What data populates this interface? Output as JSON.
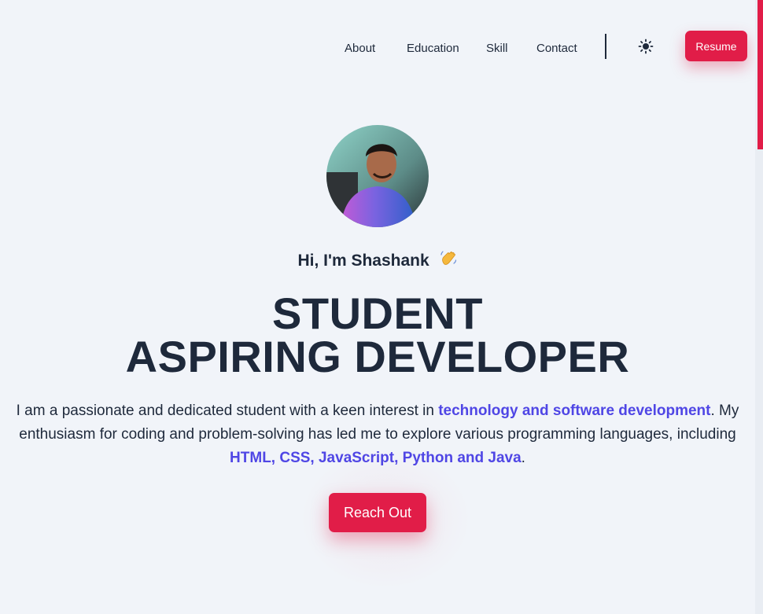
{
  "nav": {
    "links": [
      "About",
      "Education",
      "Skill",
      "Contact"
    ],
    "theme_icon": "sun-icon",
    "resume_label": "Resume"
  },
  "hero": {
    "greeting": "Hi, I'm Shashank",
    "wave_icon": "waving-hand-icon",
    "headline_line1": "STUDENT",
    "headline_line2": "ASPIRING DEVELOPER",
    "intro": {
      "part1": "I am a passionate and dedicated student with a keen interest in ",
      "highlight1": "technology and software development",
      "part2": ". My enthusiasm for coding and problem-solving has led me to explore various programming languages, including ",
      "highlight2": "HTML, CSS, JavaScript, Python and Java",
      "part3": "."
    },
    "cta_label": "Reach Out"
  },
  "colors": {
    "accent": "#e11d48",
    "highlight": "#4f46e5",
    "text": "#1e293b",
    "background": "#f1f4f9"
  }
}
